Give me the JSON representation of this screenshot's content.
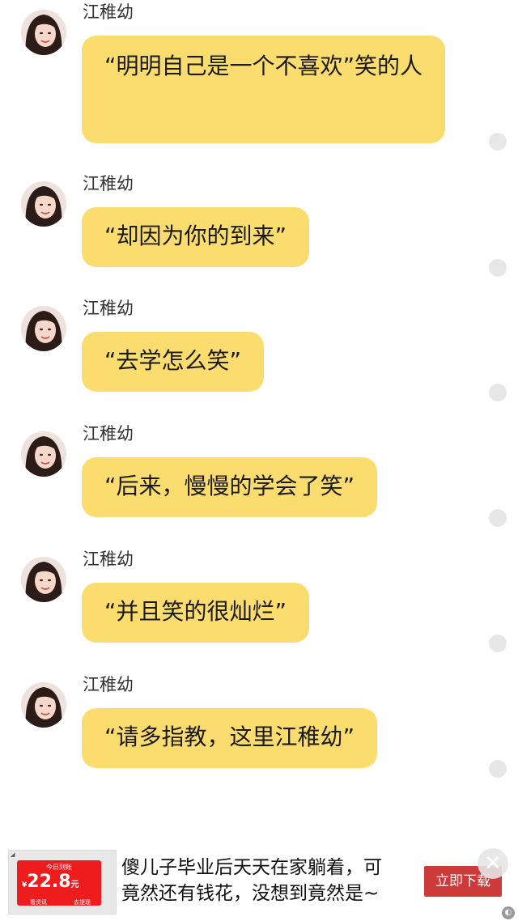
{
  "chat": {
    "messages": [
      {
        "sender": "江稚幼",
        "text": "“明明自己是一个不喜欢”笑的人"
      },
      {
        "sender": "江稚幼",
        "text": "“却因为你的到来”"
      },
      {
        "sender": "江稚幼",
        "text": "“去学怎么笑”"
      },
      {
        "sender": "江稚幼",
        "text": "“后来，慢慢的学会了笑”"
      },
      {
        "sender": "江稚幼",
        "text": "“并且笑的很灿烂”"
      },
      {
        "sender": "江稚幼",
        "text": "“请多指教，这里江稚幼”"
      }
    ]
  },
  "ad": {
    "image_top": "今日到账",
    "image_price": "22.8",
    "image_currency": "¥",
    "image_unit": "元",
    "image_btn1": "看资讯",
    "image_btn2": "去提现",
    "text": "傻儿子毕业后天天在家躺着，可竟然还有钱花，没想到竟然是~",
    "button": "立即下载",
    "close_icon": "close-icon"
  },
  "colors": {
    "bubble": "#fbdc6f",
    "ad_button": "#cd3a3a",
    "ad_price_bg": "#ee1c1c"
  }
}
